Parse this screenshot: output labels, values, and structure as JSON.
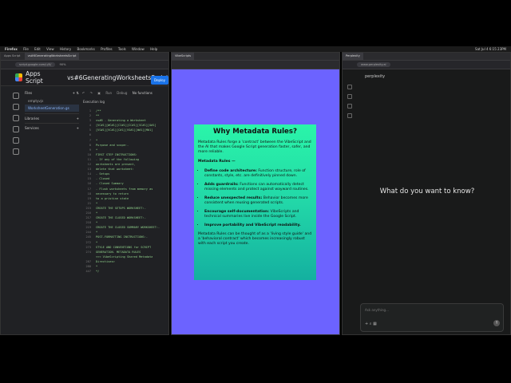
{
  "menubar": {
    "app": "Firefox",
    "items": [
      "File",
      "Edit",
      "View",
      "History",
      "Bookmarks",
      "Profiles",
      "Tools",
      "Window",
      "Help"
    ],
    "clock": "Sat Jul 4 6:15 23PM"
  },
  "apps_script": {
    "tabs": [
      "Apps Script",
      "vs#6GeneratingWorksheetsScript"
    ],
    "url": "script.google.com/u/0/",
    "zoom": "90%",
    "product_name": "Apps Script",
    "project_title": "vs#6GeneratingWorksheetsScript",
    "deploy_label": "Deploy",
    "files_label": "Files",
    "files": [
      "emptyvjs",
      "WorksheetGeneration.gs"
    ],
    "libraries_label": "Libraries",
    "services_label": "Services",
    "toolbar": {
      "run": "Run",
      "debug": "Debug",
      "functions": "No functions"
    },
    "execution_log": "Execution log",
    "code_lines": [
      {
        "n": "1",
        "t": "/**"
      },
      {
        "n": "2",
        "t": " **"
      },
      {
        "n": "3",
        "t": "vs#6 - Generating a Worksheet"
      },
      {
        "n": "4",
        "t": "[VC#1][WC#1][CI#1][CC#1][SC#1][O#1]"
      },
      {
        "n": "5",
        "t": "[VS#1][VC#1][C#1][VS#1][W#1][M#1]"
      },
      {
        "n": "6",
        "t": ""
      },
      {
        "n": "7",
        "t": "*"
      },
      {
        "n": "8",
        "t": "Purpose and scope:-"
      },
      {
        "n": "9",
        "t": "*"
      },
      {
        "n": "10",
        "t": "FIRST STEP INSTRUCTIONS:"
      },
      {
        "n": "11",
        "t": "  - If any of the following"
      },
      {
        "n": "12",
        "t": "    worksheets are present,"
      },
      {
        "n": "13",
        "t": "    delete that worksheet:"
      },
      {
        "n": "14",
        "t": "    - Setups"
      },
      {
        "n": "15",
        "t": "    - Closed"
      },
      {
        "n": "16",
        "t": "    - Closed Summary"
      },
      {
        "n": "17",
        "t": "  - Flush worksheets from memory as"
      },
      {
        "n": "18",
        "t": "    necessary to return"
      },
      {
        "n": "19",
        "t": "    to a pristine state"
      },
      {
        "n": "21",
        "t": "*"
      },
      {
        "n": "215",
        "t": "CREATE THE SETUPS WORKSHEET:-"
      },
      {
        "n": "216",
        "t": "*"
      },
      {
        "n": "217",
        "t": "CREATE THE CLOSED WORKSHEET:-"
      },
      {
        "n": "218",
        "t": "*"
      },
      {
        "n": "219",
        "t": "CREATE THE CLOSED SUMMARY WORKSHEET:-"
      },
      {
        "n": "244",
        "t": "*"
      },
      {
        "n": "245",
        "t": "POST-FORMATTING INSTRUCTIONS:-"
      },
      {
        "n": "272",
        "t": "*"
      },
      {
        "n": "273",
        "t": "STYLE AND CONVENTIONS for SCRIPT"
      },
      {
        "n": "274",
        "t": "GENERATION. METADATA RULES"
      },
      {
        "n": "",
        "t": "<<< VibeScripting Shared Metadata"
      },
      {
        "n": "287",
        "t": "Directives>"
      },
      {
        "n": "288",
        "t": "*"
      },
      {
        "n": "447",
        "t": "*/"
      }
    ]
  },
  "middle_window": {
    "tab": "VibeScripts",
    "card": {
      "title": "Why Metadata Rules?",
      "intro": "Metadata Rules forge a 'contract' between the VibeScript and the AI that makes Google Script generation faster, safer, and more reliable.",
      "subheading": "Metadata Rules —",
      "bullets": [
        {
          "bold": "Define code architecture:",
          "text": " Function structure, role of constants, style, etc. are definitively pinned down."
        },
        {
          "bold": "Adds guardrails:",
          "text": " Functions can automatically detect missing elements and protect against wayward routines."
        },
        {
          "bold": "Reduce unexpected results:",
          "text": " Behavior becomes more consistent when reusing generated scripts."
        },
        {
          "bold": "Encourage self-documentation:",
          "text": " VibeScripts and technical summaries live inside the Google Script."
        },
        {
          "bold": "Improve portability and VibeScript readability.",
          "text": ""
        }
      ],
      "closing": "Metadata Rules can be thought of as a 'living style guide' and a 'behavioral contract' which becomes increasingly robust with each script you create."
    }
  },
  "perplexity": {
    "tab": "Perplexity",
    "url": "www.perplexity.ai",
    "logo_text": "perplexity",
    "question": "What do you want to know?",
    "input_placeholder": "Ask anything..."
  }
}
